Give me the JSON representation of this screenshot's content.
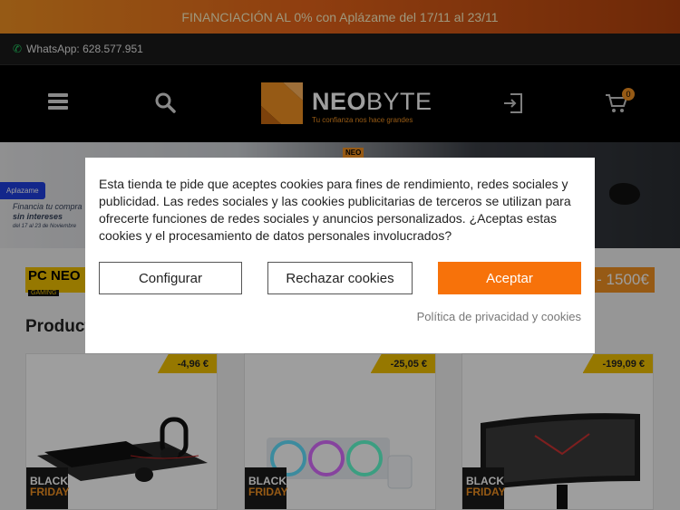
{
  "promo": {
    "text": "FINANCIACIÓN AL 0% con Aplázame del 17/11 al 23/11"
  },
  "topbar": {
    "whatsapp": "WhatsApp: 628.577.951"
  },
  "header": {
    "logo_bold": "NEO",
    "logo_light": "BYTE",
    "tagline": "Tu confianza nos hace grandes",
    "cart_count": "0"
  },
  "banner": {
    "aplazame_tag": "Aplazame",
    "finance_line1": "Financia tu compra",
    "finance_line2": "sin intereses",
    "finance_line3": "del 17 al 23 de Noviembre",
    "neo_badge": "NEO"
  },
  "pc_strip": {
    "logo_big": "PC NEO",
    "logo_small": "GAMING",
    "price": "- 1500€"
  },
  "section": {
    "title": "Product"
  },
  "products": [
    {
      "discount": "-4,96 €",
      "bf_line1": "BLACK",
      "bf_line2": "FRIDAY"
    },
    {
      "discount": "-25,05 €",
      "bf_line1": "BLACK",
      "bf_line2": "FRIDAY"
    },
    {
      "discount": "-199,09 €",
      "bf_line1": "BLACK",
      "bf_line2": "FRIDAY"
    }
  ],
  "cookie_modal": {
    "text": "Esta tienda te pide que aceptes cookies para fines de rendimiento, redes sociales y publicidad. Las redes sociales y las cookies publicitarias de terceros se utilizan para ofrecerte funciones de redes sociales y anuncios personalizados. ¿Aceptas estas cookies y el procesamiento de datos personales involucrados?",
    "configure": "Configurar",
    "reject": "Rechazar cookies",
    "accept": "Aceptar",
    "privacy": "Política de privacidad y cookies"
  },
  "colors": {
    "brand_orange": "#f39222",
    "accept_orange": "#f7720a",
    "discount_yellow": "#f2c200"
  }
}
